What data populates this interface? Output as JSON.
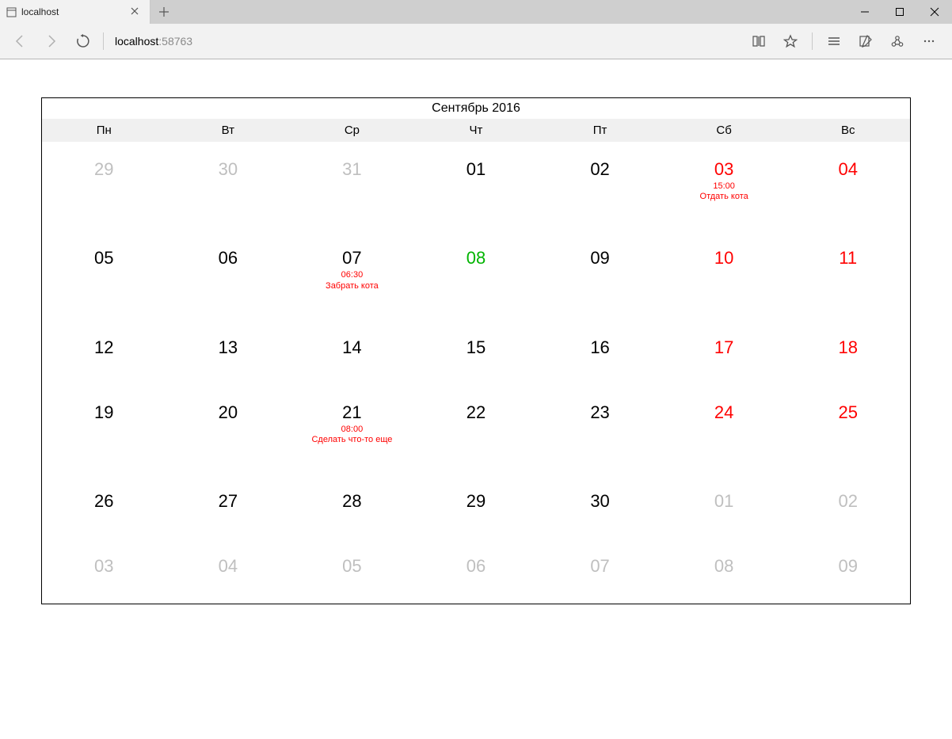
{
  "browser": {
    "tab_title": "localhost",
    "address_host": "localhost",
    "address_port": ":58763"
  },
  "calendar": {
    "title": "Сентябрь 2016",
    "weekdays": [
      "Пн",
      "Вт",
      "Ср",
      "Чт",
      "Пт",
      "Сб",
      "Вс"
    ],
    "cells": [
      {
        "num": "29",
        "out": true
      },
      {
        "num": "30",
        "out": true
      },
      {
        "num": "31",
        "out": true
      },
      {
        "num": "01"
      },
      {
        "num": "02"
      },
      {
        "num": "03",
        "weekend": true,
        "events": [
          {
            "time": "15:00",
            "text": "Отдать кота"
          }
        ]
      },
      {
        "num": "04",
        "weekend": true
      },
      {
        "num": "05"
      },
      {
        "num": "06"
      },
      {
        "num": "07",
        "events": [
          {
            "time": "06:30",
            "text": "Забрать кота"
          }
        ]
      },
      {
        "num": "08",
        "today": true
      },
      {
        "num": "09"
      },
      {
        "num": "10",
        "weekend": true
      },
      {
        "num": "11",
        "weekend": true
      },
      {
        "num": "12"
      },
      {
        "num": "13"
      },
      {
        "num": "14"
      },
      {
        "num": "15"
      },
      {
        "num": "16"
      },
      {
        "num": "17",
        "weekend": true
      },
      {
        "num": "18",
        "weekend": true
      },
      {
        "num": "19"
      },
      {
        "num": "20"
      },
      {
        "num": "21",
        "events": [
          {
            "time": "08:00",
            "text": "Сделать что-то еще"
          }
        ]
      },
      {
        "num": "22"
      },
      {
        "num": "23"
      },
      {
        "num": "24",
        "weekend": true
      },
      {
        "num": "25",
        "weekend": true
      },
      {
        "num": "26"
      },
      {
        "num": "27"
      },
      {
        "num": "28"
      },
      {
        "num": "29"
      },
      {
        "num": "30"
      },
      {
        "num": "01",
        "out": true
      },
      {
        "num": "02",
        "out": true
      },
      {
        "num": "03",
        "out": true
      },
      {
        "num": "04",
        "out": true
      },
      {
        "num": "05",
        "out": true
      },
      {
        "num": "06",
        "out": true
      },
      {
        "num": "07",
        "out": true
      },
      {
        "num": "08",
        "out": true
      },
      {
        "num": "09",
        "out": true
      }
    ]
  }
}
